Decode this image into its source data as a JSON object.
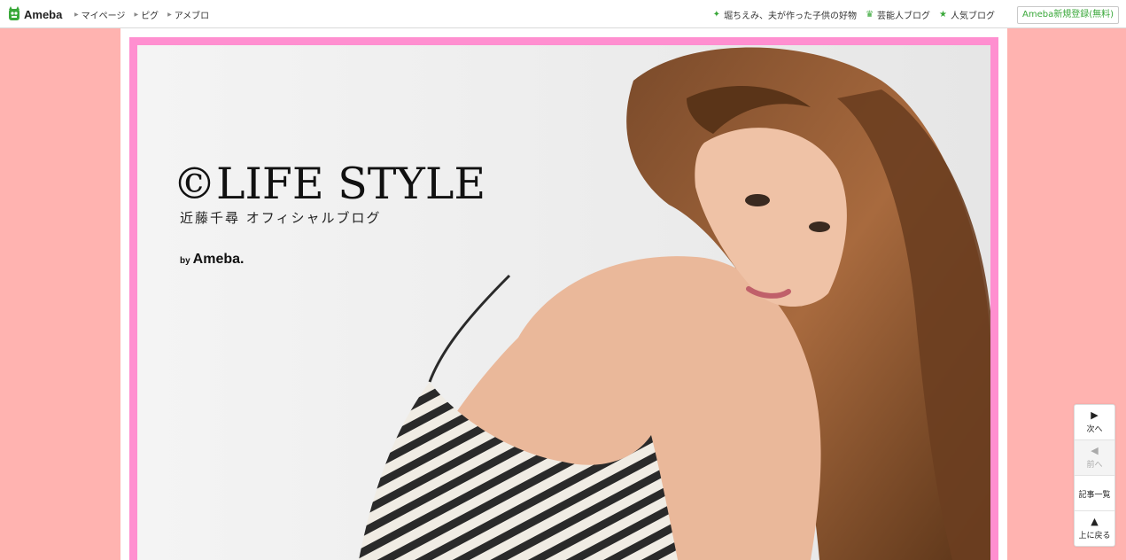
{
  "topbar": {
    "logo_text": "Ameba",
    "nav": [
      {
        "label": "マイページ"
      },
      {
        "label": "ピグ"
      },
      {
        "label": "アメブロ"
      }
    ],
    "right_links": [
      {
        "label": "堀ちえみ、夫が作った子供の好物",
        "icon": "sparkle-icon"
      },
      {
        "label": "芸能人ブログ",
        "icon": "crown-icon"
      },
      {
        "label": "人気ブログ",
        "icon": "star-icon"
      }
    ],
    "register_label": "Ameba新規登録(無料)"
  },
  "header": {
    "title": "©LIFE STYLE",
    "subtitle": "近藤千尋 オフィシャルブログ",
    "by_label": "by",
    "by_brand": "Ameba."
  },
  "pager": {
    "next_label": "次へ",
    "prev_label": "前へ",
    "list_label": "記事一覧",
    "top_label": "上に戻る",
    "next_arrow": "▶",
    "prev_arrow": "◀",
    "top_arrow": "▲"
  },
  "colors": {
    "page_background": "#ffb3b0",
    "header_frame": "#ff8fd0",
    "accent_green": "#3aa83a"
  }
}
